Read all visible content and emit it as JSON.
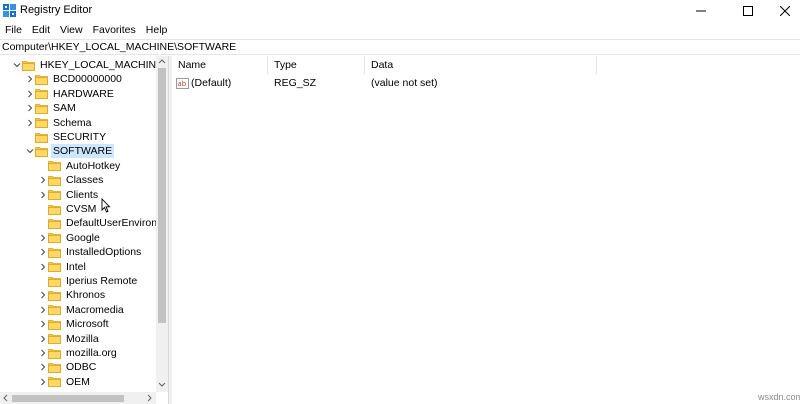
{
  "window": {
    "title": "Registry Editor",
    "icons": {
      "app": "registry-icon",
      "minimize": "minimize-icon",
      "maximize": "maximize-icon",
      "close": "close-icon"
    }
  },
  "menu": [
    "File",
    "Edit",
    "View",
    "Favorites",
    "Help"
  ],
  "address": "Computer\\HKEY_LOCAL_MACHINE\\SOFTWARE",
  "tree": [
    {
      "label": "HKEY_LOCAL_MACHINE",
      "expanded": true,
      "has_children": true
    },
    {
      "label": "BCD00000000",
      "has_children": true
    },
    {
      "label": "HARDWARE",
      "has_children": true
    },
    {
      "label": "SAM",
      "has_children": true
    },
    {
      "label": "Schema",
      "has_children": true
    },
    {
      "label": "SECURITY",
      "has_children": false
    },
    {
      "label": "SOFTWARE",
      "expanded": true,
      "selected": true,
      "has_children": true
    },
    {
      "label": "AutoHotkey",
      "has_children": false
    },
    {
      "label": "Classes",
      "has_children": true
    },
    {
      "label": "Clients",
      "has_children": true
    },
    {
      "label": "CVSM",
      "has_children": false
    },
    {
      "label": "DefaultUserEnvironn",
      "has_children": false
    },
    {
      "label": "Google",
      "has_children": true
    },
    {
      "label": "InstalledOptions",
      "has_children": true
    },
    {
      "label": "Intel",
      "has_children": true
    },
    {
      "label": "Iperius Remote",
      "has_children": false
    },
    {
      "label": "Khronos",
      "has_children": true
    },
    {
      "label": "Macromedia",
      "has_children": true
    },
    {
      "label": "Microsoft",
      "has_children": true
    },
    {
      "label": "Mozilla",
      "has_children": true
    },
    {
      "label": "mozilla.org",
      "has_children": true
    },
    {
      "label": "ODBC",
      "has_children": true
    },
    {
      "label": "OEM",
      "has_children": true
    }
  ],
  "list": {
    "columns": {
      "name": "Name",
      "type": "Type",
      "data": "Data"
    },
    "rows": [
      {
        "name": "(Default)",
        "type": "REG_SZ",
        "data": "(value not set)",
        "icon": "string-value-icon"
      }
    ]
  },
  "watermark": "wsxdn.com",
  "colors": {
    "selection": "#cce8ff",
    "folder": "#f4c542",
    "scroll": "#c2c2c2"
  }
}
